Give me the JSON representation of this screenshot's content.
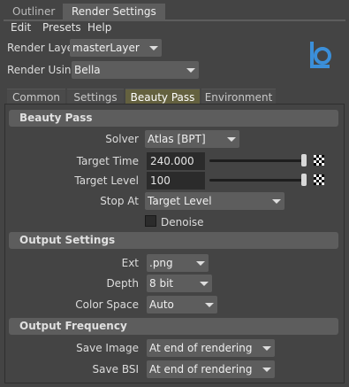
{
  "window_tabs": [
    "Outliner",
    "Render Settings"
  ],
  "menu": [
    "Edit",
    "Presets",
    "Help"
  ],
  "render_layer": {
    "label": "Render Layer",
    "value": "masterLayer"
  },
  "render_using": {
    "label": "Render Using",
    "value": "Bella"
  },
  "subtabs": [
    "Common",
    "Settings",
    "Beauty Pass",
    "Environment"
  ],
  "beauty_pass": {
    "title": "Beauty Pass",
    "solver": {
      "label": "Solver",
      "value": "Atlas [BPT]"
    },
    "target_time": {
      "label": "Target Time",
      "value": "240.000"
    },
    "target_level": {
      "label": "Target Level",
      "value": "100"
    },
    "stop_at": {
      "label": "Stop At",
      "value": "Target Level"
    },
    "denoise": {
      "label": "Denoise",
      "checked": false
    }
  },
  "output_settings": {
    "title": "Output Settings",
    "ext": {
      "label": "Ext",
      "value": ".png"
    },
    "depth": {
      "label": "Depth",
      "value": "8 bit"
    },
    "color_space": {
      "label": "Color Space",
      "value": "Auto"
    }
  },
  "output_frequency": {
    "title": "Output Frequency",
    "save_image": {
      "label": "Save Image",
      "value": "At end of rendering"
    },
    "save_bsi": {
      "label": "Save BSI",
      "value": "At end of rendering"
    }
  },
  "colors": {
    "accent_tab": "#64613f",
    "logo": "#3b8fd9"
  },
  "icons": {
    "logo": "bella-logo-icon",
    "color_swatch": "checker-icon"
  }
}
